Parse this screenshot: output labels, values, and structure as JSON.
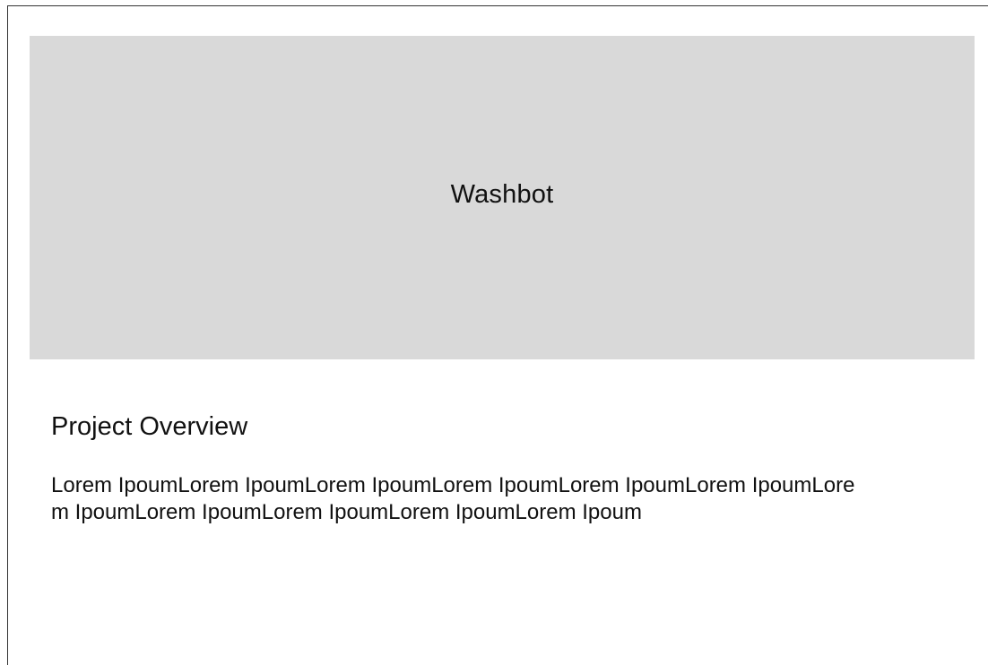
{
  "hero": {
    "title": "Washbot"
  },
  "overview": {
    "title": "Project Overview",
    "body": "Lorem IpoumLorem IpoumLorem IpoumLorem IpoumLorem IpoumLorem IpoumLorem IpoumLorem IpoumLorem IpoumLorem IpoumLorem Ipoum"
  },
  "colors": {
    "hero_background": "#d9d9d9",
    "page_background": "#ffffff",
    "text": "#111111",
    "frame_border": "#333333"
  }
}
